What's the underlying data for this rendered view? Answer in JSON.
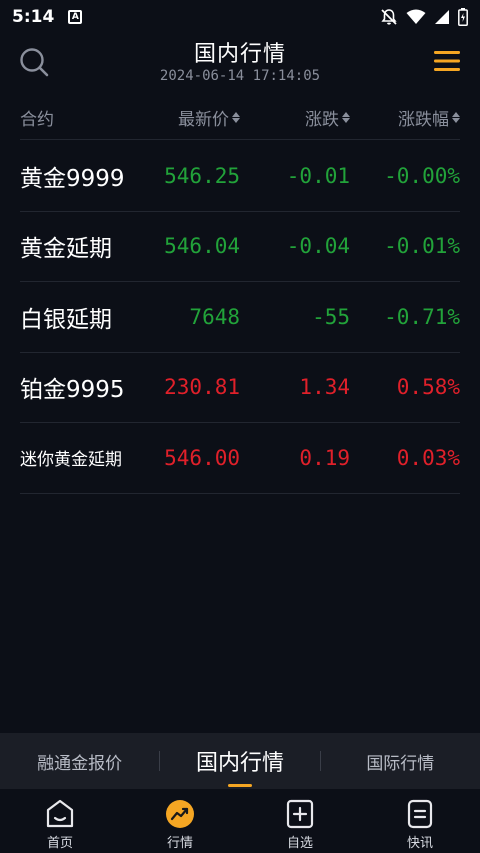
{
  "status_bar": {
    "time": "5:14",
    "a_badge": "A",
    "icons": [
      "a-badge-icon",
      "mute-icon",
      "wifi-icon",
      "signal-icon",
      "battery-icon"
    ]
  },
  "header": {
    "title": "国内行情",
    "subtitle": "2024-06-14 17:14:05",
    "icons": [
      "search-icon",
      "menu-icon"
    ]
  },
  "columns": {
    "name": "合约",
    "price": "最新价",
    "change": "涨跌",
    "pct": "涨跌幅"
  },
  "rows": [
    {
      "name": "黄金9999",
      "price": "546.25",
      "change": "-0.01",
      "pct": "-0.00%",
      "trend": "down"
    },
    {
      "name": "黄金延期",
      "price": "546.04",
      "change": "-0.04",
      "pct": "-0.01%",
      "trend": "down"
    },
    {
      "name": "白银延期",
      "price": "7648",
      "change": "-55",
      "pct": "-0.71%",
      "trend": "down"
    },
    {
      "name": "铂金9995",
      "price": "230.81",
      "change": "1.34",
      "pct": "0.58%",
      "trend": "up"
    },
    {
      "name": "迷你黄金延期",
      "price": "546.00",
      "change": "0.19",
      "pct": "0.03%",
      "trend": "up"
    }
  ],
  "tabs": [
    {
      "label": "融通金报价"
    },
    {
      "label": "国内行情"
    },
    {
      "label": "国际行情"
    }
  ],
  "bottom_nav": [
    {
      "label": "首页",
      "icon": "home-icon"
    },
    {
      "label": "行情",
      "icon": "market-icon"
    },
    {
      "label": "自选",
      "icon": "add-favorite-icon"
    },
    {
      "label": "快讯",
      "icon": "news-icon"
    }
  ],
  "colors": {
    "background": "#0c0f17",
    "accent": "#f5a623",
    "down": "#22a33a",
    "up": "#e0202a",
    "muted": "#8a8f9c"
  }
}
